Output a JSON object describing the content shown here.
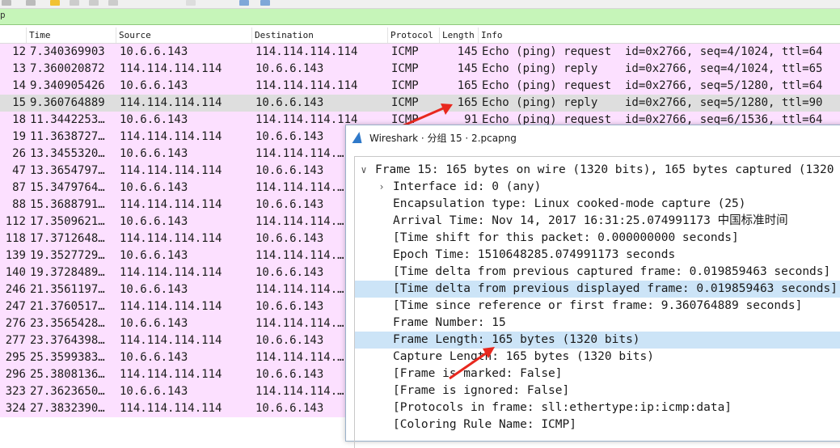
{
  "filterbar": {
    "text": "p"
  },
  "columns": [
    "Time",
    "Source",
    "Destination",
    "Protocol",
    "Length",
    "Info"
  ],
  "rows": [
    {
      "no": "12",
      "time": "7.340369903",
      "src": "10.6.6.143",
      "dst": "114.114.114.114",
      "proto": "ICMP",
      "len": "145",
      "info": "Echo (ping) request  id=0x2766, seq=4/1024, ttl=64"
    },
    {
      "no": "13",
      "time": "7.360020872",
      "src": "114.114.114.114",
      "dst": "10.6.6.143",
      "proto": "ICMP",
      "len": "145",
      "info": "Echo (ping) reply    id=0x2766, seq=4/1024, ttl=65"
    },
    {
      "no": "14",
      "time": "9.340905426",
      "src": "10.6.6.143",
      "dst": "114.114.114.114",
      "proto": "ICMP",
      "len": "165",
      "info": "Echo (ping) request  id=0x2766, seq=5/1280, ttl=64"
    },
    {
      "no": "15",
      "time": "9.360764889",
      "src": "114.114.114.114",
      "dst": "10.6.6.143",
      "proto": "ICMP",
      "len": "165",
      "info": "Echo (ping) reply    id=0x2766, seq=5/1280, ttl=90",
      "selected": true
    },
    {
      "no": "18",
      "time": "11.3442253…",
      "src": "10.6.6.143",
      "dst": "114.114.114.114",
      "proto": "ICMP",
      "len": "91",
      "info": "Echo (ping) request  id=0x2766, seq=6/1536, ttl=64"
    },
    {
      "no": "19",
      "time": "11.3638727…",
      "src": "114.114.114.114",
      "dst": "10.6.6.143",
      "proto": "",
      "len": "",
      "info": ""
    },
    {
      "no": "26",
      "time": "13.3455320…",
      "src": "10.6.6.143",
      "dst": "114.114.114.…",
      "proto": "",
      "len": "",
      "info": ""
    },
    {
      "no": "47",
      "time": "13.3654797…",
      "src": "114.114.114.114",
      "dst": "10.6.6.143",
      "proto": "",
      "len": "",
      "info": ""
    },
    {
      "no": "87",
      "time": "15.3479764…",
      "src": "10.6.6.143",
      "dst": "114.114.114.…",
      "proto": "",
      "len": "",
      "info": ""
    },
    {
      "no": "88",
      "time": "15.3688791…",
      "src": "114.114.114.114",
      "dst": "10.6.6.143",
      "proto": "",
      "len": "",
      "info": ""
    },
    {
      "no": "112",
      "time": "17.3509621…",
      "src": "10.6.6.143",
      "dst": "114.114.114.…",
      "proto": "",
      "len": "",
      "info": ""
    },
    {
      "no": "118",
      "time": "17.3712648…",
      "src": "114.114.114.114",
      "dst": "10.6.6.143",
      "proto": "",
      "len": "",
      "info": ""
    },
    {
      "no": "139",
      "time": "19.3527729…",
      "src": "10.6.6.143",
      "dst": "114.114.114.…",
      "proto": "",
      "len": "",
      "info": ""
    },
    {
      "no": "140",
      "time": "19.3728489…",
      "src": "114.114.114.114",
      "dst": "10.6.6.143",
      "proto": "",
      "len": "",
      "info": ""
    },
    {
      "no": "246",
      "time": "21.3561197…",
      "src": "10.6.6.143",
      "dst": "114.114.114.…",
      "proto": "",
      "len": "",
      "info": ""
    },
    {
      "no": "247",
      "time": "21.3760517…",
      "src": "114.114.114.114",
      "dst": "10.6.6.143",
      "proto": "",
      "len": "",
      "info": ""
    },
    {
      "no": "276",
      "time": "23.3565428…",
      "src": "10.6.6.143",
      "dst": "114.114.114.…",
      "proto": "",
      "len": "",
      "info": ""
    },
    {
      "no": "277",
      "time": "23.3764398…",
      "src": "114.114.114.114",
      "dst": "10.6.6.143",
      "proto": "",
      "len": "",
      "info": ""
    },
    {
      "no": "295",
      "time": "25.3599383…",
      "src": "10.6.6.143",
      "dst": "114.114.114.…",
      "proto": "",
      "len": "",
      "info": ""
    },
    {
      "no": "296",
      "time": "25.3808136…",
      "src": "114.114.114.114",
      "dst": "10.6.6.143",
      "proto": "",
      "len": "",
      "info": ""
    },
    {
      "no": "323",
      "time": "27.3623650…",
      "src": "10.6.6.143",
      "dst": "114.114.114.…",
      "proto": "",
      "len": "",
      "info": ""
    },
    {
      "no": "324",
      "time": "27.3832390…",
      "src": "114.114.114.114",
      "dst": "10.6.6.143",
      "proto": "",
      "len": "",
      "info": ""
    }
  ],
  "dialog": {
    "title": "Wireshark · 分组 15 · 2.pcapng",
    "title_icon": "wireshark-fin-icon",
    "tree": [
      {
        "expander": "∨",
        "text": "Frame 15: 165 bytes on wire (1320 bits), 165 bytes captured (1320",
        "indent": 0
      },
      {
        "expander": "›",
        "text": "Interface id: 0 (any)",
        "indent": 1
      },
      {
        "expander": "",
        "text": "Encapsulation type: Linux cooked-mode capture (25)",
        "indent": 1
      },
      {
        "expander": "",
        "text": "Arrival Time: Nov 14, 2017 16:31:25.074991173 中国标准时间",
        "indent": 1
      },
      {
        "expander": "",
        "text": "[Time shift for this packet: 0.000000000 seconds]",
        "indent": 1
      },
      {
        "expander": "",
        "text": "Epoch Time: 1510648285.074991173 seconds",
        "indent": 1
      },
      {
        "expander": "",
        "text": "[Time delta from previous captured frame: 0.019859463 seconds]",
        "indent": 1
      },
      {
        "expander": "",
        "text": "[Time delta from previous displayed frame: 0.019859463 seconds]",
        "indent": 1,
        "hl": true
      },
      {
        "expander": "",
        "text": "[Time since reference or first frame: 9.360764889 seconds]",
        "indent": 1
      },
      {
        "expander": "",
        "text": "Frame Number: 15",
        "indent": 1
      },
      {
        "expander": "",
        "text": "Frame Length: 165 bytes (1320 bits)",
        "indent": 1,
        "hl": true
      },
      {
        "expander": "",
        "text": "Capture Length: 165 bytes (1320 bits)",
        "indent": 1
      },
      {
        "expander": "",
        "text": "[Frame is marked: False]",
        "indent": 1
      },
      {
        "expander": "",
        "text": "[Frame is ignored: False]",
        "indent": 1
      },
      {
        "expander": "",
        "text": "[Protocols in frame: sll:ethertype:ip:icmp:data]",
        "indent": 1
      },
      {
        "expander": "",
        "text": "[Coloring Rule Name: ICMP]",
        "indent": 1
      }
    ]
  },
  "colors": {
    "row_icmp": "#fce0ff",
    "row_selected": "#dedede",
    "filter_bg": "#c6f5b9",
    "tree_highlight": "#cce4f7",
    "arrow": "#e8281e"
  }
}
